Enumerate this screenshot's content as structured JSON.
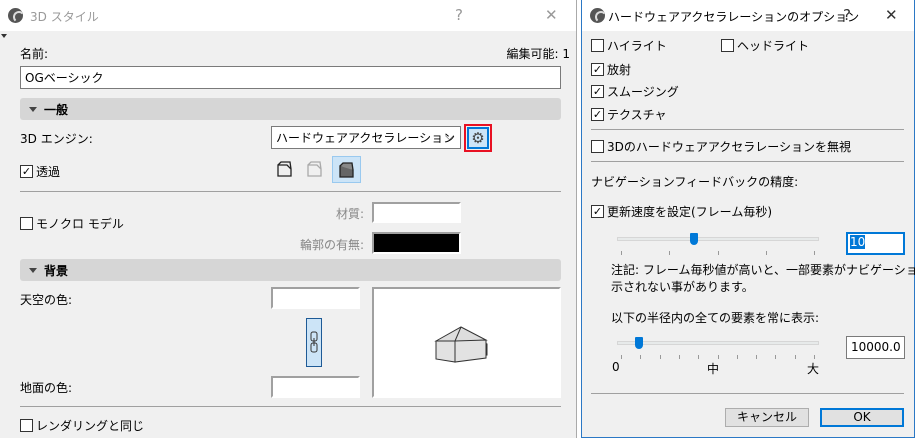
{
  "left_dialog": {
    "title": "3D スタイル",
    "help": "?",
    "close": "✕",
    "name_label": "名前:",
    "editable_label": "編集可能: 1",
    "name_value": "OGベーシック",
    "general_header": "一般",
    "engine_label": "3D エンジン:",
    "engine_value": "ハードウェアアクセラレーション",
    "transparency_label": "透過",
    "transparency_checked": true,
    "mono_label": "モノクロ モデル",
    "mono_checked": false,
    "material_label": "材質:",
    "contour_label": "輪郭の有無:",
    "material_color": "#ffffff",
    "contour_color": "#000000",
    "background_header": "背景",
    "sky_label": "天空の色:",
    "ground_label": "地面の色:",
    "same_as_rendering_label": "レンダリングと同じ",
    "same_as_rendering_checked": false
  },
  "right_dialog": {
    "title": "ハードウェアアクセラレーションのオプション",
    "help": "?",
    "close": "✕",
    "highlight_label": "ハイライト",
    "headlight_label": "ヘッドライト",
    "emission_label": "放射",
    "smoothing_label": "スムージング",
    "texture_label": "テクスチャ",
    "ignore_label": "3Dのハードウェアアクセラレーションを無視",
    "nav_precision_label": "ナビゲーションフィードバックの精度:",
    "set_rate_label": "更新速度を設定(フレーム毎秒)",
    "fps_value": "10",
    "fps_slider_fraction": 0.38,
    "note_line1": "注記: フレーム毎秒値が高いと、一部要素がナビゲーション中表",
    "note_line2": "示されない事があります。",
    "radius_label": "以下の半径内の全ての要素を常に表示:",
    "radius_value": "10000.0",
    "radius_slider_fraction": 0.11,
    "scale_min": "0",
    "scale_mid": "中",
    "scale_max": "大",
    "cancel_label": "キャンセル",
    "ok_label": "OK"
  }
}
